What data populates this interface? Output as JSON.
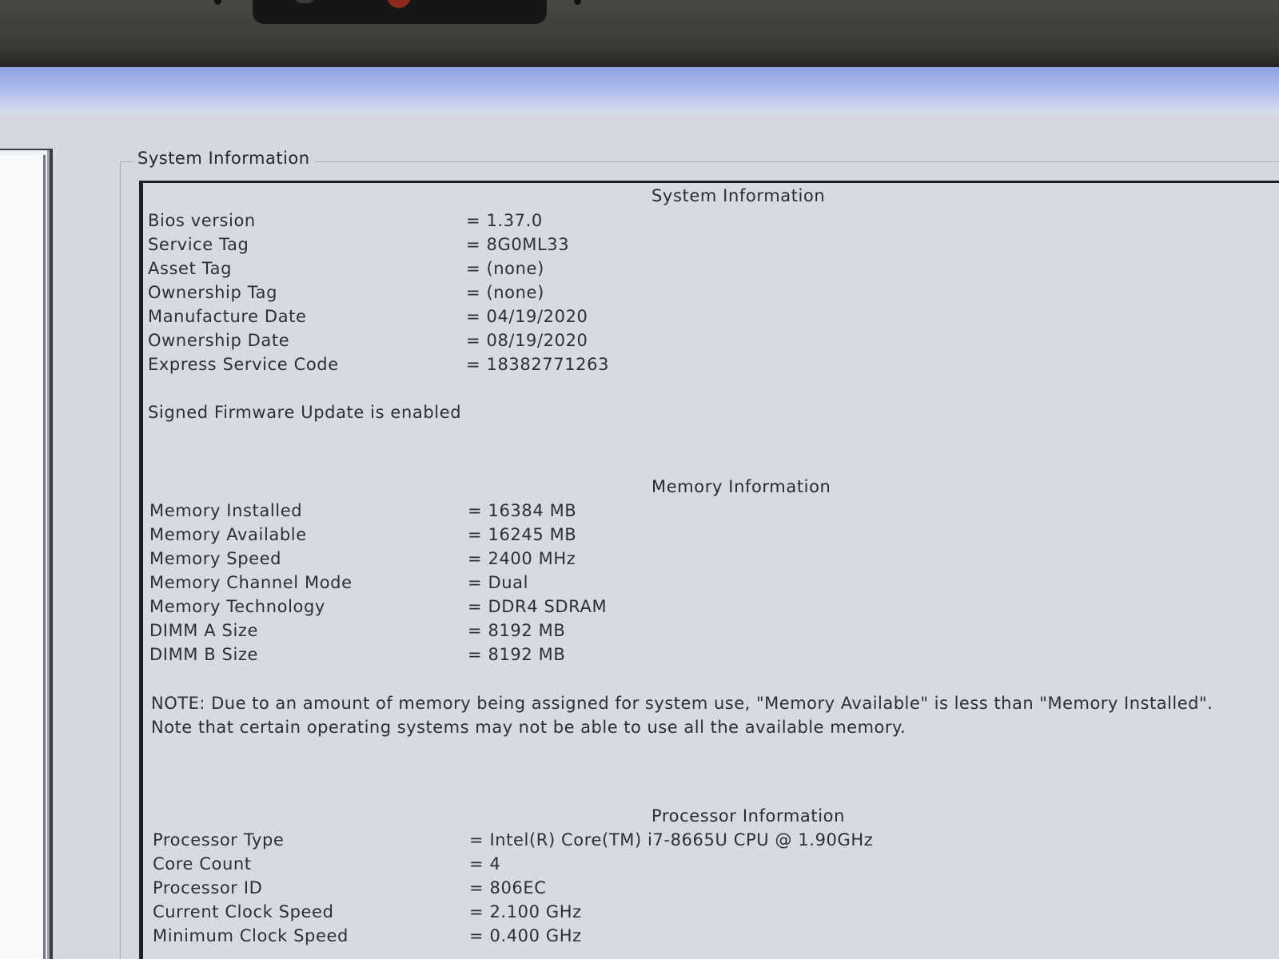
{
  "groupbox_title": "System Information",
  "system": {
    "title": "System Information",
    "rows": [
      {
        "label": "Bios version",
        "value": "1.37.0"
      },
      {
        "label": "Service Tag",
        "value": "8G0ML33"
      },
      {
        "label": "Asset Tag",
        "value": "(none)"
      },
      {
        "label": "Ownership Tag",
        "value": "(none)"
      },
      {
        "label": "Manufacture Date",
        "value": "04/19/2020"
      },
      {
        "label": "Ownership Date",
        "value": "08/19/2020"
      },
      {
        "label": "Express Service Code",
        "value": "18382771263"
      }
    ],
    "note": "Signed Firmware Update is enabled"
  },
  "memory": {
    "title": "Memory Information",
    "rows": [
      {
        "label": "Memory Installed",
        "value": "16384 MB"
      },
      {
        "label": "Memory Available",
        "value": "16245 MB"
      },
      {
        "label": "Memory Speed",
        "value": "2400 MHz"
      },
      {
        "label": "Memory Channel Mode",
        "value": "Dual"
      },
      {
        "label": "Memory Technology",
        "value": "DDR4 SDRAM"
      },
      {
        "label": "DIMM A Size",
        "value": "8192 MB"
      },
      {
        "label": "DIMM B Size",
        "value": "8192 MB"
      }
    ],
    "note": "NOTE: Due to an amount of memory being assigned for system use, \"Memory Available\" is less than \"Memory Installed\". Note that certain operating systems may not be able to use all the available memory."
  },
  "processor": {
    "title": "Processor Information",
    "rows": [
      {
        "label": "Processor Type",
        "value": "Intel(R) Core(TM) i7-8665U CPU @ 1.90GHz"
      },
      {
        "label": "Core Count",
        "value": "4"
      },
      {
        "label": "Processor ID",
        "value": "806EC"
      },
      {
        "label": "Current Clock Speed",
        "value": "2.100 GHz"
      },
      {
        "label": "Minimum Clock Speed",
        "value": "0.400 GHz"
      }
    ]
  }
}
